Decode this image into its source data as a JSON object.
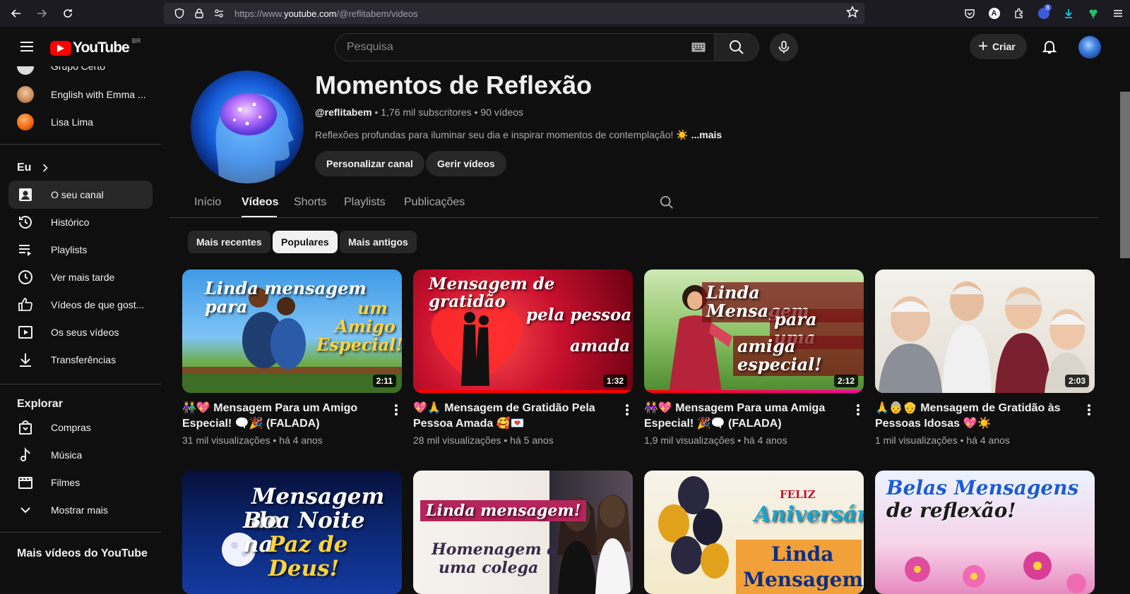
{
  "browser": {
    "url_prefix": "https://www.",
    "url_domain": "youtube.com",
    "url_path": "/@reflitabem/videos",
    "ext_badge": "8"
  },
  "header": {
    "logo_text": "YouTube",
    "country": "BR",
    "search_placeholder": "Pesquisa",
    "create_label": "Criar",
    "create_plus": "+"
  },
  "sidebar": {
    "subscriptions": [
      {
        "label": "Grupo Certo",
        "color": "#cccccc"
      },
      {
        "label": "English with Emma ...",
        "color": "#d7a06a"
      },
      {
        "label": "Lisa Lima",
        "color": "#f26a12"
      }
    ],
    "you_section": "Eu",
    "you_items": [
      {
        "label": "O seu canal",
        "icon": "user-box-icon"
      },
      {
        "label": "Histórico",
        "icon": "history-icon"
      },
      {
        "label": "Playlists",
        "icon": "playlist-icon"
      },
      {
        "label": "Ver mais tarde",
        "icon": "clock-icon"
      },
      {
        "label": "Vídeos de que gost...",
        "icon": "thumbs-up-icon"
      },
      {
        "label": "Os seus vídeos",
        "icon": "video-icon"
      },
      {
        "label": "Transferências",
        "icon": "download-icon"
      }
    ],
    "explore_section": "Explorar",
    "explore_items": [
      {
        "label": "Compras",
        "icon": "bag-icon"
      },
      {
        "label": "Música",
        "icon": "music-icon"
      },
      {
        "label": "Filmes",
        "icon": "film-icon"
      },
      {
        "label": "Mostrar mais",
        "icon": "chevron-down-icon"
      }
    ],
    "more_section": "Mais vídeos do YouTube"
  },
  "channel": {
    "name": "Momentos de Reflexão",
    "handle": "@reflitabem",
    "stats": " • 1,76 mil subscritores • 90 vídeos",
    "description": "Reflexões profundas para iluminar seu dia e inspirar momentos de contemplação! ☀️ ",
    "more_label": "...mais",
    "customize_label": "Personalizar canal",
    "manage_label": "Gerir vídeos"
  },
  "tabs": [
    "Início",
    "Vídeos",
    "Shorts",
    "Playlists",
    "Publicações"
  ],
  "active_tab": "Vídeos",
  "chips": [
    "Mais recentes",
    "Populares",
    "Mais antigos"
  ],
  "active_chip": "Populares",
  "videos": [
    {
      "title": "👫💖 Mensagem Para um Amigo Especial! 🗨️🎉 (FALADA)",
      "views": "31 mil visualizações • há 4 anos",
      "duration": "2:11",
      "thumb_text": [
        "Linda mensagem para",
        "um",
        "Amigo",
        "Especial!"
      ]
    },
    {
      "title": "💖🙏 Mensagem de Gratidão Pela Pessoa Amada 🥰💌",
      "views": "28 mil visualizações • há 5 anos",
      "duration": "1:32",
      "thumb_text": [
        "Mensagem de gratidão",
        "pela pessoa",
        "amada"
      ]
    },
    {
      "title": "👭💖 Mensagem Para uma Amiga Especial! 🎉🗨️ (FALADA)",
      "views": "1,9 mil visualizações • há 4 anos",
      "duration": "2:12",
      "thumb_text": [
        "Linda Mensagem",
        "para uma",
        "amiga especial!"
      ]
    },
    {
      "title": "🙏👵👴 Mensagem de Gratidão às Pessoas Idosas 💖☀️",
      "views": "1 mil visualizações • há 4 anos",
      "duration": "2:03",
      "thumb_text": []
    }
  ],
  "videos_row2": [
    {
      "thumb_text": [
        "Mensagem de",
        "Boa Noite na",
        "Paz de Deus!"
      ]
    },
    {
      "thumb_text": [
        "Linda mensagem!",
        "Homenagem a",
        "uma colega"
      ]
    },
    {
      "thumb_text": [
        "FELIZ",
        "Aniversário",
        "Linda",
        "Mensagem!"
      ]
    },
    {
      "thumb_text": [
        "Belas Mensagens",
        "de reflexão!"
      ]
    }
  ]
}
